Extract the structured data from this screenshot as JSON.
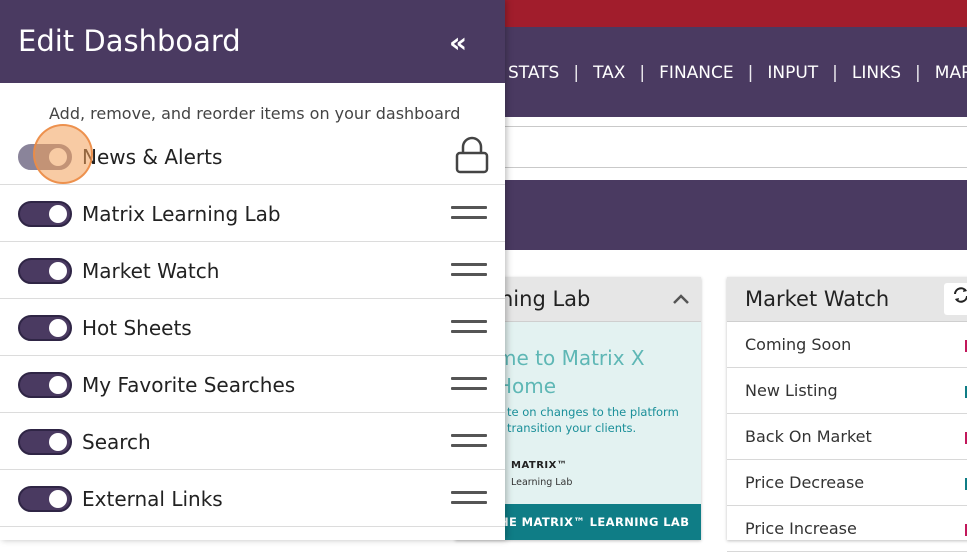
{
  "app": {
    "nav": [
      "STATS",
      "TAX",
      "FINANCE",
      "INPUT",
      "LINKS",
      "MARKET"
    ]
  },
  "colors": {
    "brand_purple": "#4a3a61",
    "top_red": "#a11d2c",
    "teal": "#0f7d86",
    "toggle_on": "#4a3a61",
    "click_highlight": "#f3a05a"
  },
  "cards": {
    "learning_lab": {
      "title": "ning Lab",
      "welcome_line1": "me to Matrix X",
      "welcome_line2": "Home",
      "sub_line1": "te on changes to the platform",
      "sub_line2": "transition your clients.",
      "logo": "MATRIX™",
      "logo_sub": "Learning Lab",
      "footer": "HE MATRIX™ LEARNING LAB"
    },
    "market_watch": {
      "title": "Market Watch",
      "refresh_icon": "refresh-icon",
      "rows": [
        {
          "label": "Coming Soon",
          "color": "#c2185b"
        },
        {
          "label": "New Listing",
          "color": "#0f7d86"
        },
        {
          "label": "Back On Market",
          "color": "#c2185b"
        },
        {
          "label": "Price Decrease",
          "color": "#0f7d86"
        },
        {
          "label": "Price Increase",
          "color": "#c2185b"
        }
      ]
    }
  },
  "panel": {
    "title": "Edit Dashboard",
    "collapse_icon": "«",
    "instructions": "Add, remove, and reorder items on your dashboard",
    "items": [
      {
        "label": "News & Alerts",
        "enabled": true,
        "locked": true
      },
      {
        "label": "Matrix Learning Lab",
        "enabled": true,
        "locked": false
      },
      {
        "label": "Market Watch",
        "enabled": true,
        "locked": false
      },
      {
        "label": "Hot Sheets",
        "enabled": true,
        "locked": false
      },
      {
        "label": "My Favorite Searches",
        "enabled": true,
        "locked": false
      },
      {
        "label": "Search",
        "enabled": true,
        "locked": false
      },
      {
        "label": "External Links",
        "enabled": true,
        "locked": false
      }
    ]
  }
}
